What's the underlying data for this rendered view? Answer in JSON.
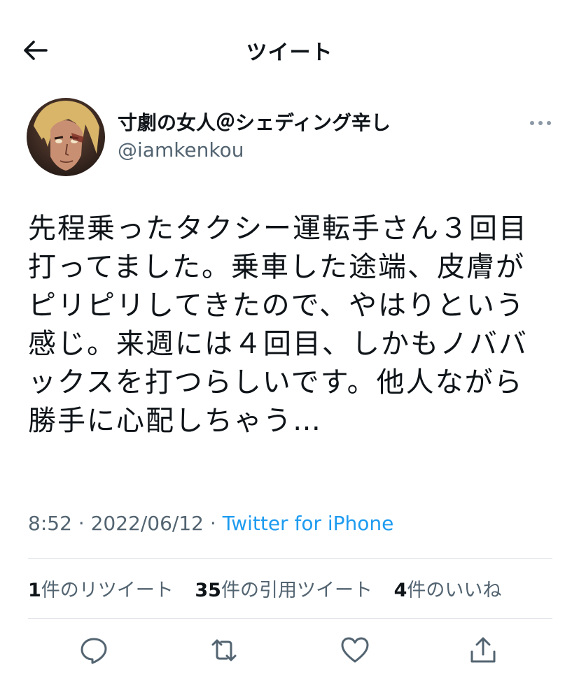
{
  "header": {
    "title": "ツイート",
    "back_icon": "arrow-left-icon"
  },
  "tweet": {
    "author": {
      "display_name": "寸劇の女人＠シェディング辛し",
      "handle": "@iamkenkou",
      "avatar_icon": "avatar-image"
    },
    "more_icon": "ellipsis-icon",
    "text_lines": [
      "先程乗ったタクシー運転手さん３回目",
      "打ってました。乗車した途端、皮膚が",
      "ピリピリしてきたので、やはりという",
      "感じ。来週には４回目、しかもノババ",
      "ックスを打つらしいです。他人ながら",
      "勝手に心配しちゃう…"
    ],
    "time": "8:52",
    "separator": "·",
    "date": "2022/06/12",
    "source": "Twitter for iPhone"
  },
  "stats": {
    "retweets": {
      "count": "1",
      "label": "件のリツイート"
    },
    "quotes": {
      "count": "35",
      "label": "件の引用ツイート"
    },
    "likes": {
      "count": "4",
      "label": "件のいいね"
    }
  },
  "actions": {
    "reply_icon": "reply-icon",
    "retweet_icon": "retweet-icon",
    "like_icon": "heart-icon",
    "share_icon": "share-icon"
  },
  "colors": {
    "text": "#0f1419",
    "secondary": "#536471",
    "link": "#1d9bf0",
    "divider": "#e1e6ea"
  }
}
